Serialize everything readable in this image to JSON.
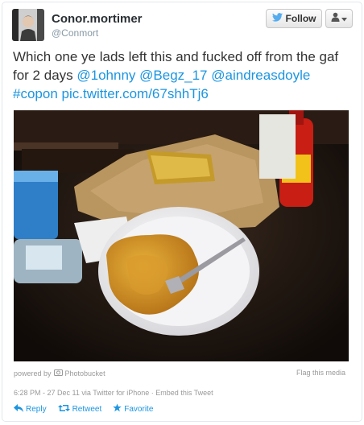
{
  "user": {
    "display_name": "Conor.mortimer",
    "screen_name": "@Conmort"
  },
  "buttons": {
    "follow_label": "Follow"
  },
  "tweet": {
    "text_part1": "Which one ye lads left this and fucked off from the gaf for 2 days ",
    "mention1": "@1ohnny",
    "mention2": "@Begz_17",
    "mention3": "@aindreasdoyle",
    "hashtag": "#copon",
    "link": "pic.twitter.com/67shhTj6"
  },
  "media": {
    "powered_by": "powered by",
    "provider": "Photobucket",
    "flag_label": "Flag this media"
  },
  "meta": {
    "timestamp": "6:28 PM - 27 Dec 11",
    "via": "via Twitter for iPhone",
    "embed_label": "Embed this Tweet"
  },
  "actions": {
    "reply": "Reply",
    "retweet": "Retweet",
    "favorite": "Favorite"
  },
  "colors": {
    "link": "#1b95e0",
    "muted": "#999999",
    "twitter_blue": "#55acee"
  }
}
